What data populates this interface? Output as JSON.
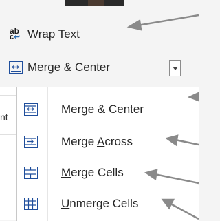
{
  "ribbon": {
    "wrap_text": {
      "label": "Wrap Text",
      "icon": "wrap-text-icon"
    },
    "merge_center": {
      "label": "Merge & Center",
      "icon": "merge-center-icon"
    },
    "sheet_fragment": "nt"
  },
  "menu": {
    "items": [
      {
        "pre": "Merge & ",
        "accel": "C",
        "post": "enter",
        "icon": "merge-center-icon"
      },
      {
        "pre": "Merge ",
        "accel": "A",
        "post": "cross",
        "icon": "merge-across-icon"
      },
      {
        "pre": "",
        "accel": "M",
        "post": "erge Cells",
        "icon": "merge-cells-icon"
      },
      {
        "pre": "",
        "accel": "U",
        "post": "nmerge Cells",
        "icon": "unmerge-cells-icon"
      }
    ]
  },
  "colors": {
    "icon_blue": "#1f4e9c",
    "annotation_arrow": "#8a8a8a",
    "ribbon_bg": "#f4f4f4"
  }
}
